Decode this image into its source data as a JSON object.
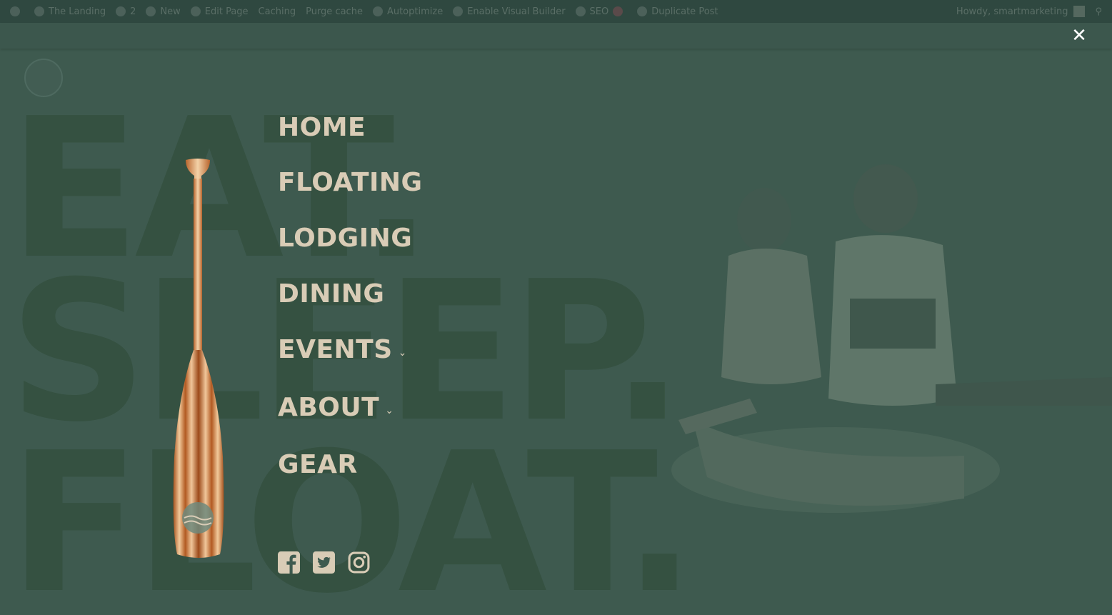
{
  "admin_bar": {
    "items": [
      {
        "icon": "wordpress-icon",
        "label": ""
      },
      {
        "icon": "home-icon",
        "label": "The Landing"
      },
      {
        "icon": "updates-icon",
        "label": "2"
      },
      {
        "icon": "plus-icon",
        "label": "New"
      },
      {
        "icon": "pencil-icon",
        "label": "Edit Page"
      },
      {
        "icon": "",
        "label": "Caching"
      },
      {
        "icon": "",
        "label": "Purge cache"
      },
      {
        "icon": "gauge-icon",
        "label": "Autoptimize"
      },
      {
        "icon": "divi-icon",
        "label": "Enable Visual Builder"
      },
      {
        "icon": "seo-icon",
        "label": "SEO"
      },
      {
        "icon": "status-dot-icon",
        "label": ""
      },
      {
        "icon": "copy-icon",
        "label": "Duplicate Post"
      }
    ],
    "greeting": "Howdy, smartmarketing"
  },
  "background": {
    "words": [
      "EAT.",
      "SLEEP.",
      "FLOAT."
    ]
  },
  "menu": {
    "items": [
      {
        "label": "HOME",
        "has_submenu": false
      },
      {
        "label": "FLOATING",
        "has_submenu": false
      },
      {
        "label": "LODGING",
        "has_submenu": false
      },
      {
        "label": "DINING",
        "has_submenu": false
      },
      {
        "label": "EVENTS",
        "has_submenu": true
      },
      {
        "label": "ABOUT",
        "has_submenu": true
      },
      {
        "label": "GEAR",
        "has_submenu": false
      }
    ]
  },
  "social": [
    "facebook-icon",
    "twitter-icon",
    "instagram-icon"
  ],
  "colors": {
    "overlay": "#3e5a4f",
    "menu_text": "#d9ccb6",
    "close": "#ffffff"
  }
}
